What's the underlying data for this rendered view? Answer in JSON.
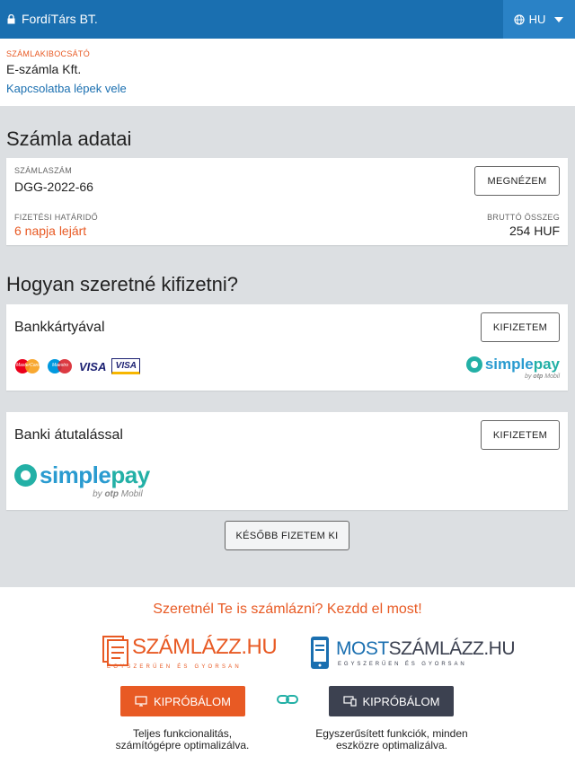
{
  "topbar": {
    "brand": "FordíTárs BT.",
    "language": "HU"
  },
  "issuer": {
    "caption": "SZÁMLAKIBOCSÁTÓ",
    "name": "E-számla Kft.",
    "contact_link": "Kapcsolatba lépek vele"
  },
  "invoice": {
    "title": "Számla adatai",
    "number_label": "SZÁMLASZÁM",
    "number": "DGG-2022-66",
    "view_button": "MEGNÉZEM",
    "due_label": "FIZETÉSI HATÁRIDŐ",
    "due_status": "6 napja lejárt",
    "gross_label": "BRUTTÓ ÖSSZEG",
    "gross_amount": "254 HUF"
  },
  "payment": {
    "title": "Hogyan szeretné kifizetni?",
    "card": {
      "label": "Bankkártyával",
      "button": "KIFIZETEM",
      "logos": [
        "MasterCard",
        "Maestro",
        "VISA",
        "VISA"
      ]
    },
    "transfer": {
      "label": "Banki átutalással",
      "button": "KIFIZETEM"
    },
    "later_button": "KÉSŐBB FIZETEM KI",
    "provider": {
      "part1": "simple",
      "part2": "pay",
      "by": "by",
      "otp": "otp",
      "mobil": "Mobil"
    }
  },
  "promo": {
    "headline": "Szeretnél Te is számlázni? Kezdd el most!",
    "logo_left": {
      "text": "SZÁMLÁZZ.HU",
      "tagline": "EGYSZERŰEN ÉS GYORSAN"
    },
    "logo_right": {
      "text1": "MOST",
      "text2": "SZÁMLÁZZ.HU",
      "tagline": "EGYSZERŰEN ÉS GYORSAN"
    },
    "try_left": "KIPRÓBÁLOM",
    "try_right": "KIPRÓBÁLOM",
    "desc_left_1": "Teljes funkcionalitás,",
    "desc_left_2": "számítógépre optimalizálva.",
    "desc_right_1": "Egyszerűsített funkciók, minden",
    "desc_right_2": "eszközre optimalizálva."
  },
  "colors": {
    "primary_blue": "#1a6fb0",
    "accent_orange": "#e85a24",
    "dark_button": "#3c4150",
    "green": "#23b0a6"
  },
  "icons": [
    "lock-icon",
    "globe-icon",
    "caret-down-icon",
    "monitor-icon",
    "devices-icon",
    "link-icon"
  ]
}
